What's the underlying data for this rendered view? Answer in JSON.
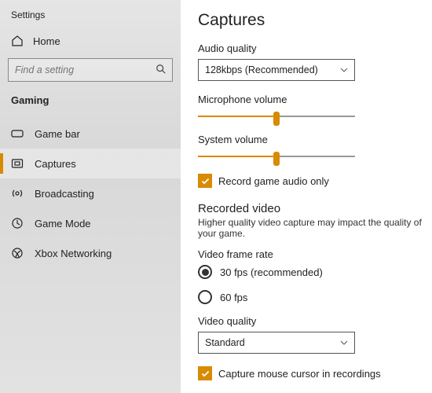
{
  "app_title": "Settings",
  "home_label": "Home",
  "search": {
    "placeholder": "Find a setting"
  },
  "section": "Gaming",
  "nav": [
    {
      "label": "Game bar",
      "selected": false
    },
    {
      "label": "Captures",
      "selected": true
    },
    {
      "label": "Broadcasting",
      "selected": false
    },
    {
      "label": "Game Mode",
      "selected": false
    },
    {
      "label": "Xbox Networking",
      "selected": false
    }
  ],
  "page": {
    "title": "Captures",
    "audio_quality_label": "Audio quality",
    "audio_quality_value": "128kbps (Recommended)",
    "mic_label": "Microphone volume",
    "mic_value": 50,
    "sys_label": "System volume",
    "sys_value": 50,
    "record_audio_only": "Record game audio only",
    "recorded_video_heading": "Recorded video",
    "recorded_video_desc": "Higher quality video capture may impact the quality of your game.",
    "frame_rate_label": "Video frame rate",
    "frame_rate_options": [
      "30 fps (recommended)",
      "60 fps"
    ],
    "video_quality_label": "Video quality",
    "video_quality_value": "Standard",
    "capture_cursor": "Capture mouse cursor in recordings"
  },
  "colors": {
    "accent": "#d88a00"
  }
}
